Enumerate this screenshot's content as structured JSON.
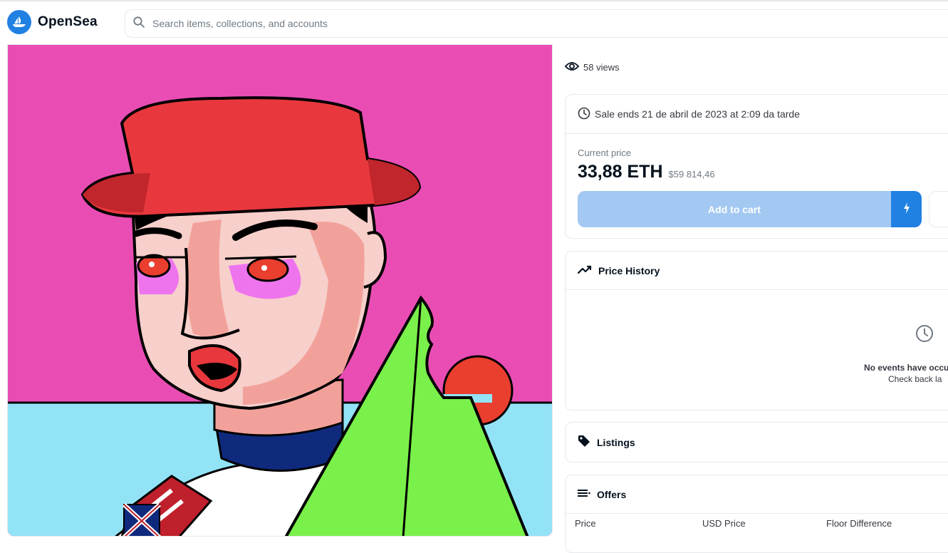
{
  "header": {
    "brand": "OpenSea",
    "search_placeholder": "Search items, collections, and accounts"
  },
  "item": {
    "views": "58 views"
  },
  "sale": {
    "ends_text": "Sale ends 21 de abril de 2023 at 2:09 da tarde",
    "current_price_label": "Current price",
    "price_eth": "33,88 ETH",
    "price_usd": "$59 814,46",
    "add_to_cart_label": "Add to cart"
  },
  "price_history": {
    "title": "Price History",
    "empty_title": "No events have occu",
    "empty_sub": "Check back la"
  },
  "listings": {
    "title": "Listings"
  },
  "offers": {
    "title": "Offers",
    "columns": [
      "Price",
      "USD Price",
      "Floor Difference"
    ]
  },
  "colors": {
    "brand_blue": "#2081e2",
    "cart_disabled": "#a3c9f2",
    "art_background": "#e94db4",
    "art_sea": "#93e3f7"
  },
  "icons": [
    "opensea-logo-icon",
    "search-icon",
    "eye-icon",
    "clock-icon",
    "lightning-icon",
    "trend-line-icon",
    "tag-icon",
    "list-icon"
  ]
}
